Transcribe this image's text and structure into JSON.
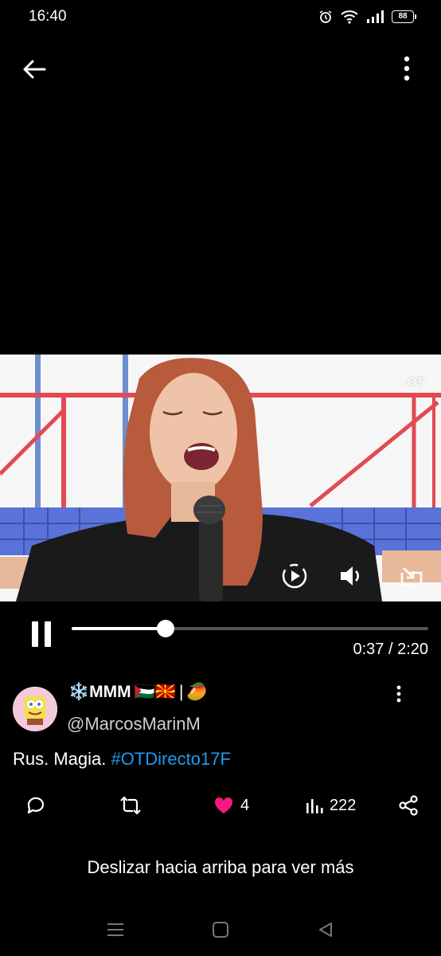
{
  "status_bar": {
    "time": "16:40",
    "icons": [
      "alarm-icon",
      "wifi-icon",
      "signal-icon"
    ],
    "battery": "88"
  },
  "top_bar": {
    "back_icon": "arrow-left-icon",
    "more_icon": "more-vertical-icon"
  },
  "video": {
    "watermark": "OT",
    "controls": [
      "autoplay-icon",
      "volume-icon",
      "minimize-icon"
    ]
  },
  "player": {
    "state": "playing",
    "progress": 0.264,
    "timecode": "0:37 / 2:20"
  },
  "tweet": {
    "display_name_prefix": "❄️MMM",
    "display_name_flags": "🇵🇸🇲🇰",
    "display_name_separator": "|",
    "display_name_suffix": "🥭",
    "handle": "@MarcosMarinM",
    "text_plain": "Rus. Magia. ",
    "hashtag": "#OTDirecto17F",
    "actions": {
      "reply_icon": "reply-icon",
      "retweet_icon": "retweet-icon",
      "like_icon": "heart-icon",
      "like_count": "4",
      "views_icon": "views-icon",
      "view_count": "222",
      "share_icon": "share-icon"
    },
    "like_color": "#f91880",
    "hashtag_color": "#1d9bf0"
  },
  "swipe_hint": "Deslizar hacia arriba para ver más",
  "nav_bar": [
    "menu-icon",
    "home-icon",
    "back-icon"
  ]
}
